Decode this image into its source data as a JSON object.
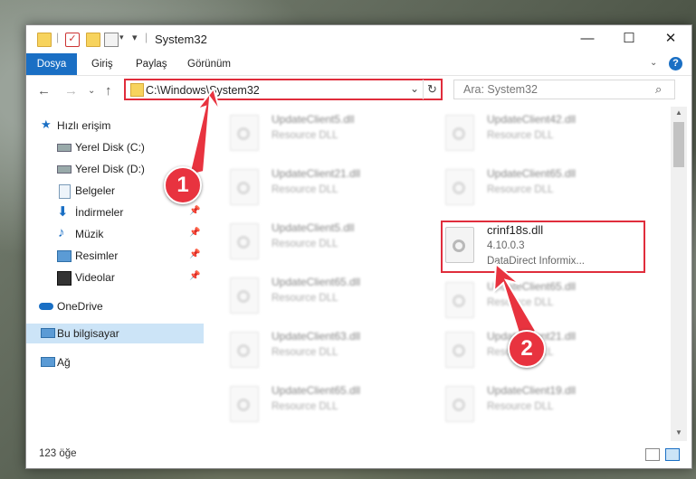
{
  "window": {
    "title": "System32",
    "controls": [
      "—",
      "☐",
      "✕"
    ]
  },
  "ribbon": {
    "tabs": [
      "Dosya",
      "Giriş",
      "Paylaş",
      "Görünüm"
    ],
    "help": "?"
  },
  "nav": {
    "address": "C:\\Windows\\System32",
    "search_placeholder": "Ara: System32"
  },
  "sidebar": {
    "items": [
      {
        "label": "Hızlı erişim",
        "icon": "star-icon"
      },
      {
        "label": "Yerel Disk (C:)",
        "icon": "drive-icon"
      },
      {
        "label": "Yerel Disk (D:)",
        "icon": "drive-icon"
      },
      {
        "label": "Belgeler",
        "icon": "documents-icon"
      },
      {
        "label": "İndirmeler",
        "icon": "download-icon"
      },
      {
        "label": "Müzik",
        "icon": "music-icon"
      },
      {
        "label": "Resimler",
        "icon": "pictures-icon"
      },
      {
        "label": "Videolar",
        "icon": "video-icon"
      },
      {
        "label": "OneDrive",
        "icon": "cloud-icon"
      },
      {
        "label": "Bu bilgisayar",
        "icon": "computer-icon"
      },
      {
        "label": "Ağ",
        "icon": "network-icon"
      }
    ]
  },
  "files": {
    "col1": [
      {
        "name": "UpdateClient5.dll",
        "sub": "Resource DLL"
      },
      {
        "name": "UpdateClient21.dll",
        "sub": "Resource DLL"
      },
      {
        "name": "UpdateClient5.dll",
        "sub": "Resource DLL"
      },
      {
        "name": "UpdateClient65.dll",
        "sub": "Resource DLL"
      },
      {
        "name": "UpdateClient63.dll",
        "sub": "Resource DLL"
      },
      {
        "name": "UpdateClient65.dll",
        "sub": "Resource DLL"
      }
    ],
    "col2": [
      {
        "name": "UpdateClient42.dll",
        "sub": "Resource DLL"
      },
      {
        "name": "UpdateClient65.dll",
        "sub": "Resource DLL"
      },
      {
        "name": "crinf18s.dll",
        "sub": "4.10.0.3",
        "sub2": "DataDirect Informix..."
      },
      {
        "name": "UpdateClient65.dll",
        "sub": "Resource DLL"
      },
      {
        "name": "UpdateClient21.dll",
        "sub": "Resource DLL"
      },
      {
        "name": "UpdateClient19.dll",
        "sub": "Resource DLL"
      }
    ]
  },
  "status": {
    "count": "123 öğe"
  },
  "callouts": [
    "1",
    "2"
  ],
  "colors": {
    "accent": "#1a6fc4",
    "highlight": "#e02d3c",
    "selected": "#cce4f7"
  }
}
